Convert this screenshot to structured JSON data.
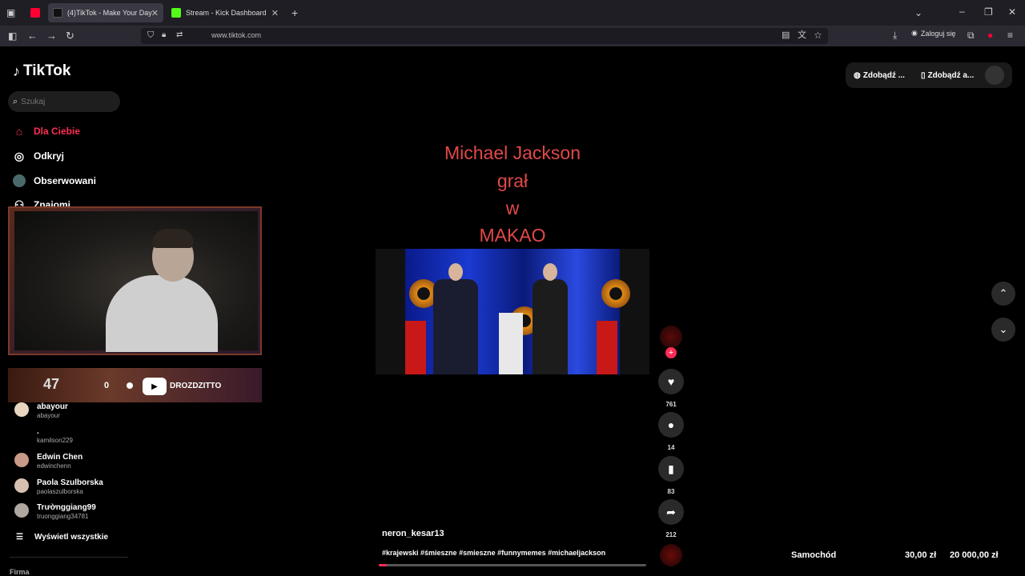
{
  "browser": {
    "tabs": [
      {
        "label": "",
        "favicon_color": "#ff0033"
      },
      {
        "label": "(4)TikTok - Make Your Day",
        "favicon_color": "#000000"
      },
      {
        "label": "Stream - Kick Dashboard",
        "favicon_color": "#53fc18"
      }
    ],
    "new_tab_icon": "plus-icon",
    "url": "www.tiktok.com",
    "login_label": "Zaloguj się"
  },
  "sidebar": {
    "logo": "TikTok",
    "search_placeholder": "Szukaj",
    "nav": [
      {
        "label": "Dla Ciebie",
        "icon": "home-icon"
      },
      {
        "label": "Odkryj",
        "icon": "compass-icon"
      },
      {
        "label": "Obserwowani",
        "icon": "following-icon"
      },
      {
        "label": "Znajomi",
        "icon": "friends-icon"
      }
    ],
    "following": [
      {
        "name": "abayour",
        "handle": "abayour"
      },
      {
        "name": ".",
        "handle": "kamilson229"
      },
      {
        "name": "Edwin Chen",
        "handle": "edwinchenn"
      },
      {
        "name": "Paola Szulborska",
        "handle": "paolaszulborska"
      },
      {
        "name": "Trườnggiang99",
        "handle": "truonggiang34781"
      }
    ],
    "show_all": "Wyświetl wszystkie",
    "footer": "Firma"
  },
  "overlay": {
    "banner_number": "47",
    "banner_count": "0",
    "banner_name": "DROZDZITTO"
  },
  "video": {
    "caption_lines": [
      "Michael Jackson",
      "grał",
      "w",
      "MAKAO"
    ],
    "author": "neron_kesar13",
    "hashtags": "#krajewski #śmieszne #smieszne #funnymemes #michaeljackson",
    "progress": 0.03
  },
  "actions": {
    "likes": "761",
    "comments": "14",
    "saves": "83",
    "shares": "212"
  },
  "top_right": {
    "btn1": "Zdobądź ...",
    "btn2": "Zdobądź a..."
  },
  "ticker": {
    "label": "Samochód",
    "current": "30,00 zł",
    "goal": "20 000,00 zł"
  }
}
